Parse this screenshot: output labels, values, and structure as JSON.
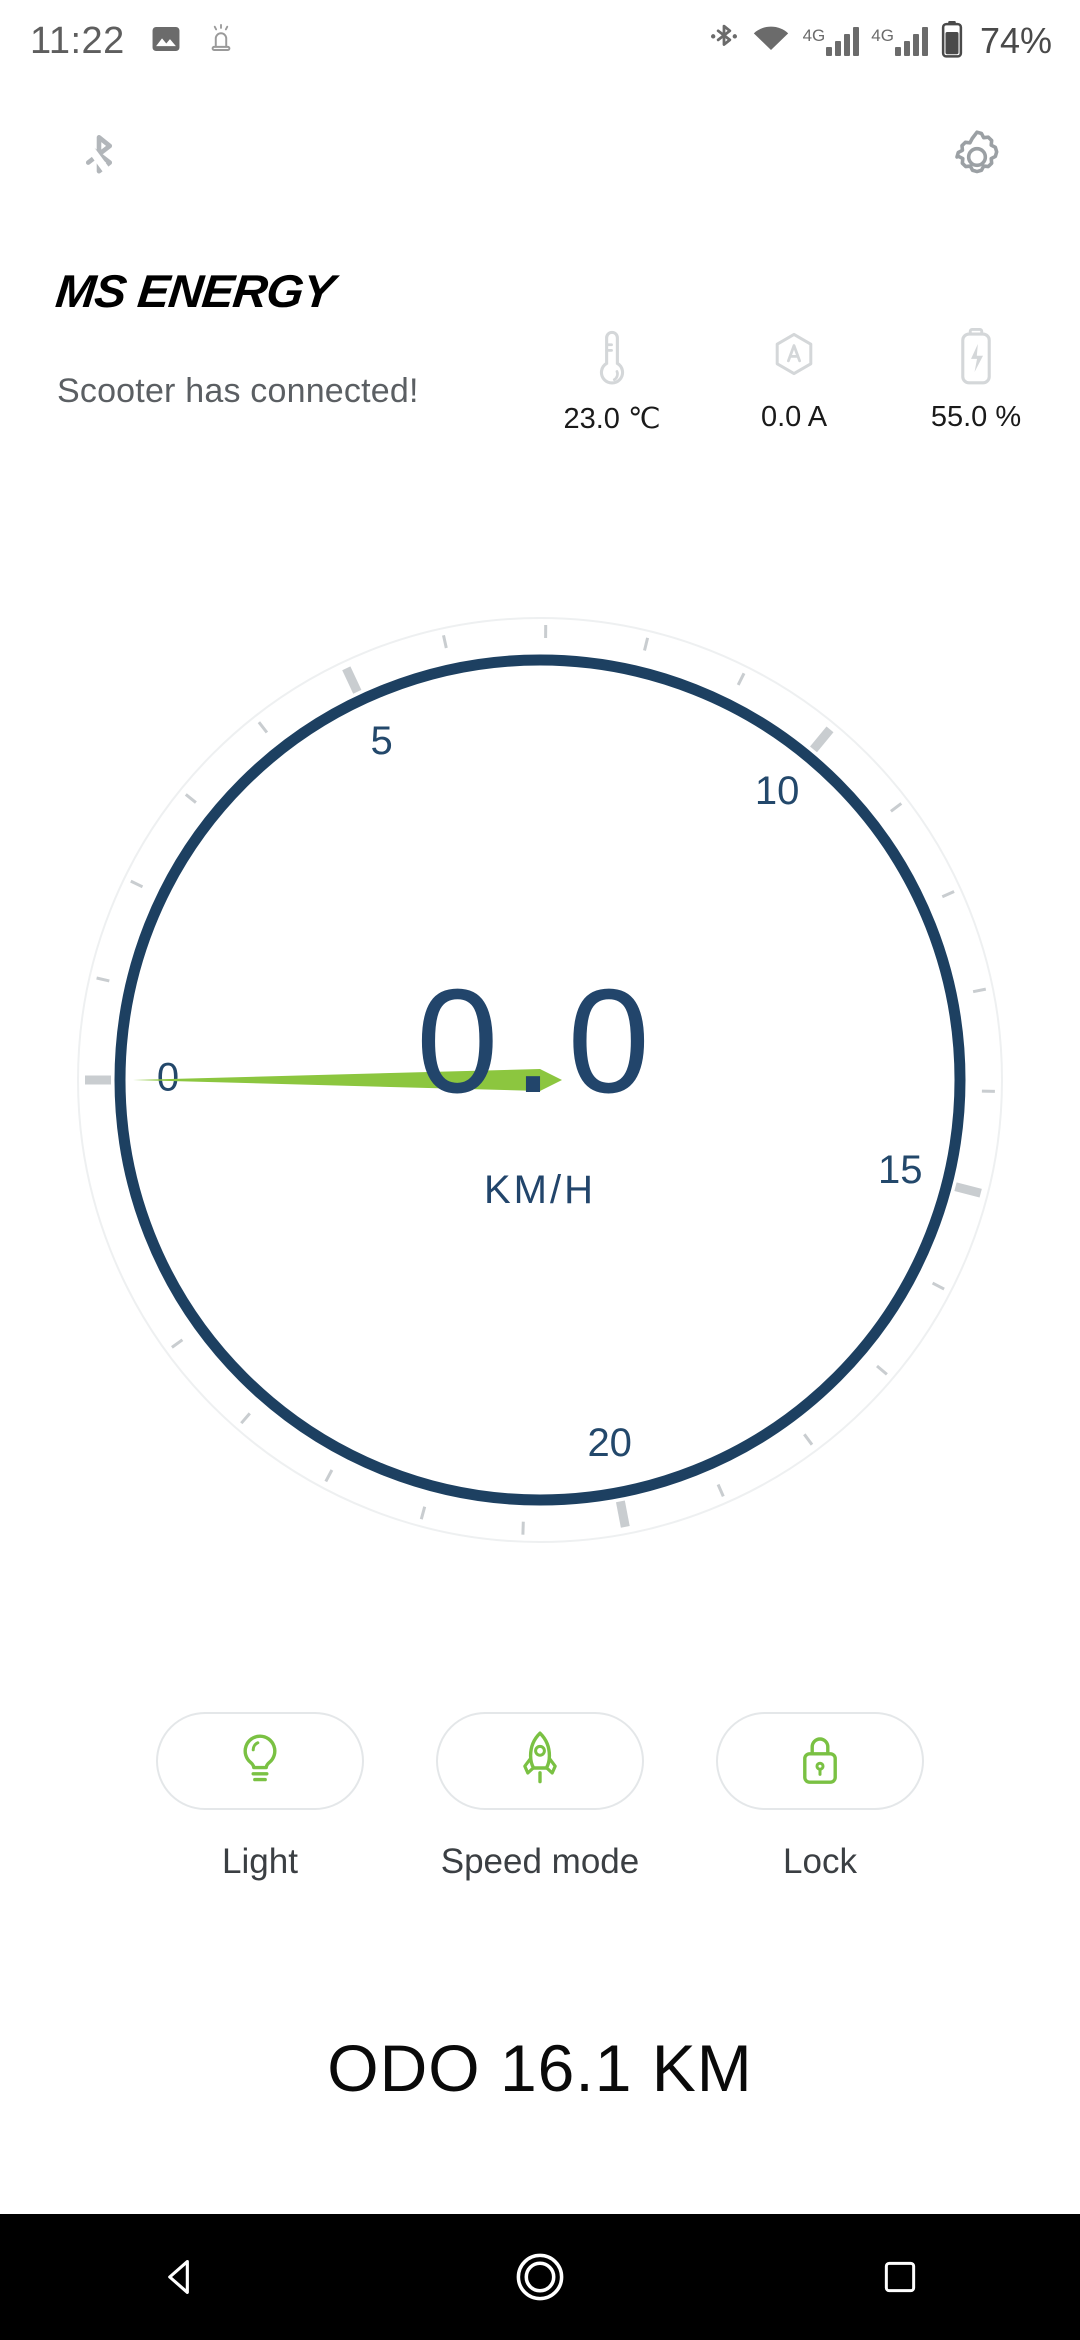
{
  "statusbar": {
    "time": "11:22",
    "icons_left": [
      "gallery-icon",
      "alarm-icon"
    ],
    "icons_right": [
      "bluetooth-icon",
      "wifi-icon",
      "signal-icon",
      "signal-icon",
      "battery-icon"
    ],
    "network_label_1": "4G",
    "network_label_2": "4G",
    "battery_percent": "74%"
  },
  "appbar": {
    "bluetooth_off_icon": "bluetooth-off-icon",
    "settings_icon": "gear-icon"
  },
  "brand": {
    "name": "MS ENERGY",
    "status_message": "Scooter has connected!"
  },
  "readouts": [
    {
      "icon": "thermometer-icon",
      "value": "23.0 ℃",
      "name": "temperature"
    },
    {
      "icon": "ampere-icon",
      "value": "0.0 A",
      "name": "current"
    },
    {
      "icon": "battery-level-icon",
      "value": "55.0 %",
      "name": "battery-level"
    }
  ],
  "gauge": {
    "speed_value": "0.0",
    "unit": "KM/H",
    "tick_labels": [
      "0",
      "5",
      "10",
      "15",
      "20"
    ],
    "min": 0,
    "max": 25,
    "current": 0.0,
    "ring_color": "#1d4061",
    "needle_color": "#8cc63f",
    "tick_color": "#c9cdd0"
  },
  "actions": [
    {
      "icon": "lightbulb-icon",
      "label": "Light",
      "name": "light"
    },
    {
      "icon": "rocket-icon",
      "label": "Speed mode",
      "name": "speed-mode"
    },
    {
      "icon": "lock-icon",
      "label": "Lock",
      "name": "lock"
    }
  ],
  "odometer": {
    "text": "ODO 16.1 KM"
  },
  "navbar": {
    "back": "back-triangle-icon",
    "home": "home-circle-icon",
    "recents": "recents-square-icon"
  },
  "colors": {
    "accent_green": "#8cc63f",
    "navy": "#1d4061",
    "text_gray": "#5b5f63"
  }
}
